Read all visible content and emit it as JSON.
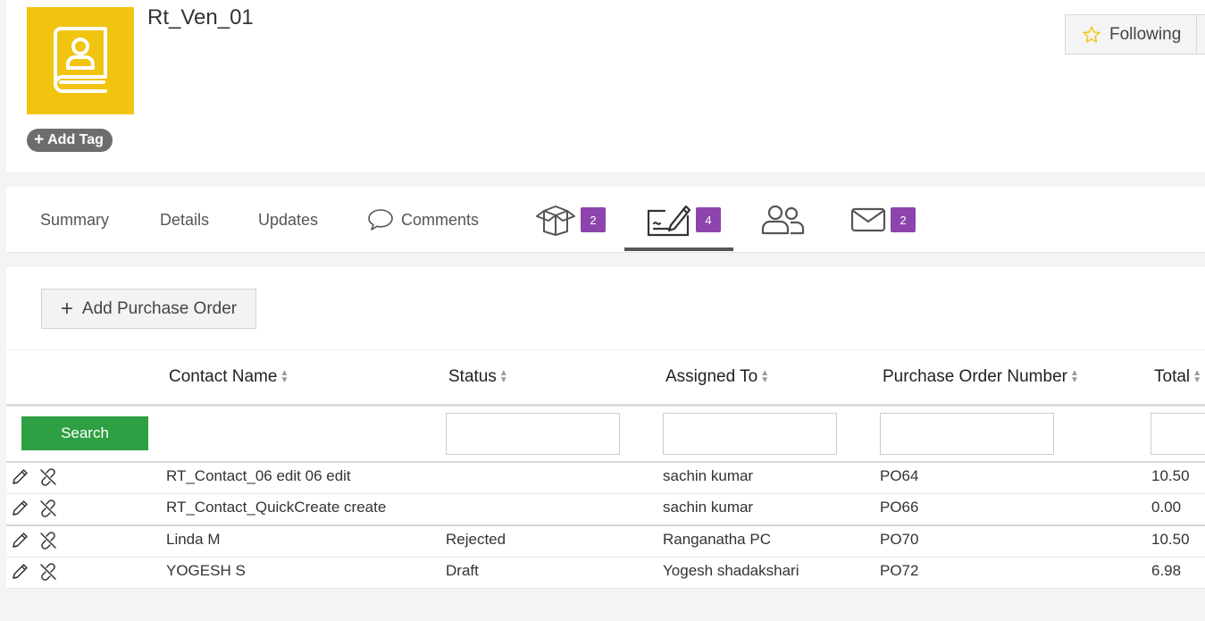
{
  "header": {
    "title": "Rt_Ven_01",
    "add_tag_label": "Add Tag",
    "following_label": "Following",
    "avatar_icon": "contact-book-icon",
    "accent_color": "#f1c40f"
  },
  "tabs": {
    "summary": "Summary",
    "details": "Details",
    "updates": "Updates",
    "comments": "Comments",
    "products_count": "2",
    "purchase_orders_count": "4",
    "emails_count": "2",
    "badge_color": "#8e44ad"
  },
  "purchase_orders": {
    "add_button_label": "Add Purchase Order",
    "search_button_label": "Search",
    "columns": [
      "Contact Name",
      "Status",
      "Assigned To",
      "Purchase Order Number",
      "Total"
    ],
    "rows": [
      {
        "contact": "RT_Contact_06 edit 06 edit",
        "status": "",
        "assigned": "sachin kumar",
        "po": "PO64",
        "total": "10.50"
      },
      {
        "contact": "RT_Contact_QuickCreate create",
        "status": "",
        "assigned": "sachin kumar",
        "po": "PO66",
        "total": "0.00"
      },
      {
        "contact": "Linda M",
        "status": "Rejected",
        "assigned": "Ranganatha PC",
        "po": "PO70",
        "total": "10.50"
      },
      {
        "contact": "YOGESH S",
        "status": "Draft",
        "assigned": "Yogesh shadakshari",
        "po": "PO72",
        "total": "6.98"
      }
    ]
  }
}
